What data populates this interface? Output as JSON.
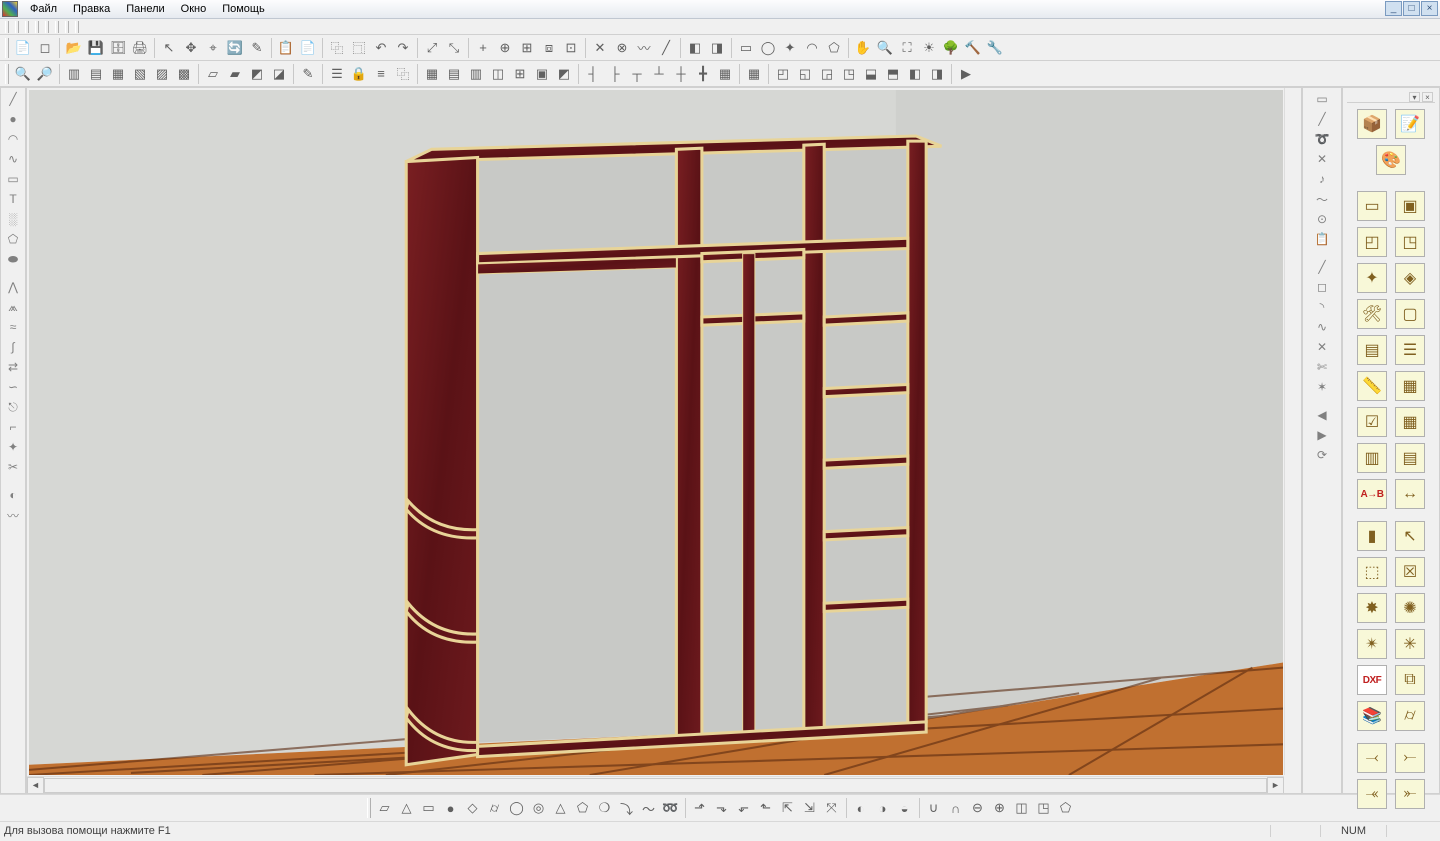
{
  "menu": {
    "file": "Файл",
    "edit": "Правка",
    "panels": "Панели",
    "window": "Окно",
    "help": "Помощь"
  },
  "win_controls": {
    "min": "_",
    "max": "□",
    "close": "×"
  },
  "status": {
    "hint": "Для вызова помощи нажмите F1",
    "num": "NUM"
  },
  "toolbar1_icons": [
    "file-new",
    "file-blank",
    "separator",
    "file-open",
    "file-save",
    "file-saveas",
    "print",
    "separator",
    "pointer",
    "snap",
    "pick",
    "refresh",
    "pencil",
    "separator",
    "copy",
    "paste",
    "separator",
    "group",
    "ungroup",
    "undo",
    "redo",
    "separator",
    "transform1",
    "transform2",
    "separator",
    "mirror1",
    "mirror2",
    "mirror3",
    "mirror4",
    "mirror5",
    "separator",
    "cross",
    "crossx",
    "draft",
    "line",
    "separator",
    "align-l",
    "align-r",
    "separator",
    "rect",
    "oval",
    "star",
    "arc",
    "poly",
    "separator",
    "hand",
    "zoom",
    "fit",
    "sun",
    "tree",
    "hammer",
    "wrench"
  ],
  "toolbar2_icons": [
    "zoom-lens",
    "zoom-in",
    "separator",
    "box1",
    "box2",
    "box3",
    "box4",
    "box5",
    "box6",
    "separator",
    "sheet1",
    "sheet2",
    "sheet3",
    "sheet4",
    "separator",
    "edit-pen",
    "separator",
    "layer",
    "lock",
    "align",
    "group",
    "separator",
    "grid1",
    "grid2",
    "grid3",
    "grid4",
    "grid5",
    "grid6",
    "grid7",
    "separator",
    "dist1",
    "dist2",
    "dist3",
    "dist4",
    "dist5",
    "dist6",
    "dist7",
    "separator",
    "table",
    "separator",
    "wall1",
    "wall2",
    "wall3",
    "wall4",
    "wall5",
    "wall6",
    "wall7",
    "wall8",
    "separator",
    "play"
  ],
  "left_tools": [
    "line",
    "circle",
    "arc",
    "spline",
    "rect",
    "text",
    "hatch",
    "poly",
    "ellipse",
    null,
    "arrow-up",
    "arrow-uu",
    "arrow-wave",
    "s-curve",
    "reverse",
    "n-curve",
    "break",
    "corner",
    "star",
    "scissor",
    null,
    "half",
    "draft"
  ],
  "right_vtools": [
    "rect",
    "line",
    "curl",
    "cross",
    "note",
    "wave",
    "center",
    "copy",
    null,
    "line2",
    "square",
    "arc2",
    "curve2",
    "cross2",
    "cut",
    "star3",
    null,
    "arrow-l",
    "arrow-r",
    "rot"
  ],
  "palette_top": [
    {
      "icon": "box3d",
      "alt": "sheet-edit"
    },
    {
      "icon": "palette",
      "alt": null
    }
  ],
  "palette_main": [
    [
      "panel-plain",
      "panel-frame"
    ],
    [
      "panel-l",
      "panel-u"
    ],
    [
      "panel-star",
      "panel-diamond"
    ],
    [
      "hammer-x",
      "panel-outline"
    ],
    [
      "doc-list",
      "doc-lines"
    ],
    [
      "ruler-note",
      "table"
    ],
    [
      "panel-check",
      "table-grid"
    ],
    [
      "table-mini",
      "table-col"
    ],
    [
      "arrow-ab",
      "arrow-flip"
    ],
    [
      null,
      null
    ],
    [
      "wood",
      "arrow-black"
    ],
    [
      "box-3d",
      "box-x-red"
    ],
    [
      "burst",
      "glow"
    ],
    [
      "burst-k",
      "burst-g"
    ],
    [
      "dxf",
      "box-stack"
    ],
    [
      "book",
      "cyl"
    ]
  ],
  "palette_bottom": [
    [
      "end-l",
      "end-r"
    ],
    [
      "end-l2",
      "end-r2"
    ]
  ],
  "bottom_icons": [
    "topo",
    "tri",
    "rect",
    "circle",
    "diamond",
    "cyl",
    "sphere",
    "torus",
    "cone",
    "prism",
    "teardrop",
    "bend",
    "wave",
    "twist",
    "separator",
    "extr1",
    "extr2",
    "extr3",
    "extr4",
    "extr5",
    "extr6",
    "extr7",
    "separator",
    "rev1",
    "rev2",
    "rev3",
    "separator",
    "bool1",
    "bool2",
    "bool3",
    "bool4",
    "bool5",
    "cube",
    "poly"
  ]
}
